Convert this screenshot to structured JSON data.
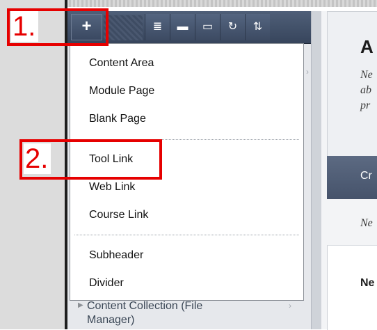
{
  "toolbar": {
    "add_label": "+",
    "buttons": [
      {
        "icon": "list-icon",
        "glyph": "≣"
      },
      {
        "icon": "folder-icon",
        "glyph": "▬"
      },
      {
        "icon": "window-icon",
        "glyph": "▭"
      },
      {
        "icon": "refresh-icon",
        "glyph": "↻"
      },
      {
        "icon": "sort-icon",
        "glyph": "⇅"
      }
    ]
  },
  "menu": {
    "groups": [
      [
        "Content Area",
        "Module Page",
        "Blank Page"
      ],
      [
        "Tool Link",
        "Web Link",
        "Course Link"
      ],
      [
        "Subheader",
        "Divider"
      ]
    ]
  },
  "below_item": "Content Collection (File Manager)",
  "content": {
    "title": "A",
    "desc": "Ne ab pr",
    "create": "Cr",
    "note": "Ne",
    "bold": "Ne"
  },
  "annotations": {
    "step1": "1.",
    "step2": "2."
  },
  "colors": {
    "accent": "#e60000",
    "toolbar": "#46536b"
  }
}
